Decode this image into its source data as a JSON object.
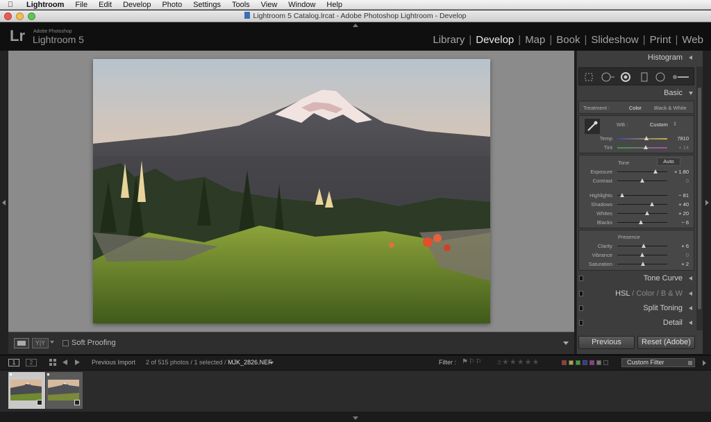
{
  "menubar": {
    "items": [
      "Lightroom",
      "File",
      "Edit",
      "Develop",
      "Photo",
      "Settings",
      "Tools",
      "View",
      "Window",
      "Help"
    ]
  },
  "window": {
    "title": "Lightroom 5 Catalog.lrcat - Adobe Photoshop Lightroom - Develop"
  },
  "identity": {
    "logo": "Lr",
    "brand_small": "Adobe Photoshop",
    "product": "Lightroom 5"
  },
  "modules": [
    "Library",
    "Develop",
    "Map",
    "Book",
    "Slideshow",
    "Print",
    "Web"
  ],
  "modules_active": "Develop",
  "toolbar": {
    "yy_label": "Y|Y",
    "soft_proofing": "Soft Proofing"
  },
  "panels": {
    "histogram": "Histogram",
    "basic": "Basic",
    "tone_curve": "Tone Curve",
    "hsl": "HSL",
    "hsl_sep1": "/",
    "color": "Color",
    "hsl_sep2": "/",
    "bw": "B & W",
    "split_toning": "Split Toning",
    "detail": "Detail"
  },
  "basic": {
    "treatment_label": "Treatment :",
    "treatment_color": "Color",
    "treatment_bw": "Black & White",
    "wb_label": "WB :",
    "wb_value": "Custom",
    "temp_label": "Temp",
    "temp_value": "7810",
    "tint_label": "Tint",
    "tint_value": "+ 14",
    "tone_label": "Tone",
    "auto_label": "Auto",
    "presence_label": "Presence",
    "sliders_tone": [
      {
        "label": "Exposure",
        "value": "+ 1.80",
        "pos": 0.76
      },
      {
        "label": "Contrast",
        "value": "0",
        "pos": 0.5
      },
      {
        "label": "Highlights",
        "value": "− 81",
        "pos": 0.1
      },
      {
        "label": "Shadows",
        "value": "+ 40",
        "pos": 0.7
      },
      {
        "label": "Whites",
        "value": "+ 20",
        "pos": 0.6
      },
      {
        "label": "Blacks",
        "value": "− 6",
        "pos": 0.47
      }
    ],
    "sliders_presence": [
      {
        "label": "Clarity",
        "value": "+ 6",
        "pos": 0.53
      },
      {
        "label": "Vibrance",
        "value": "0",
        "pos": 0.5
      },
      {
        "label": "Saturation",
        "value": "+ 2",
        "pos": 0.51
      }
    ],
    "temp_pos": 0.59,
    "tint_pos": 0.57
  },
  "buttons": {
    "previous": "Previous",
    "reset": "Reset (Adobe)"
  },
  "filmstrip": {
    "view1": "1",
    "view2": "2",
    "source": "Previous Import",
    "count": "2 of 515 photos / 1 selected /",
    "filename": "MJK_2826.NEF",
    "filter_label": "Filter :",
    "custom_filter": "Custom Filter"
  },
  "colors": {
    "accent": "#eaeaea",
    "panel_bg": "#3d3d3d",
    "canvas_bg": "#8b8b8b"
  }
}
